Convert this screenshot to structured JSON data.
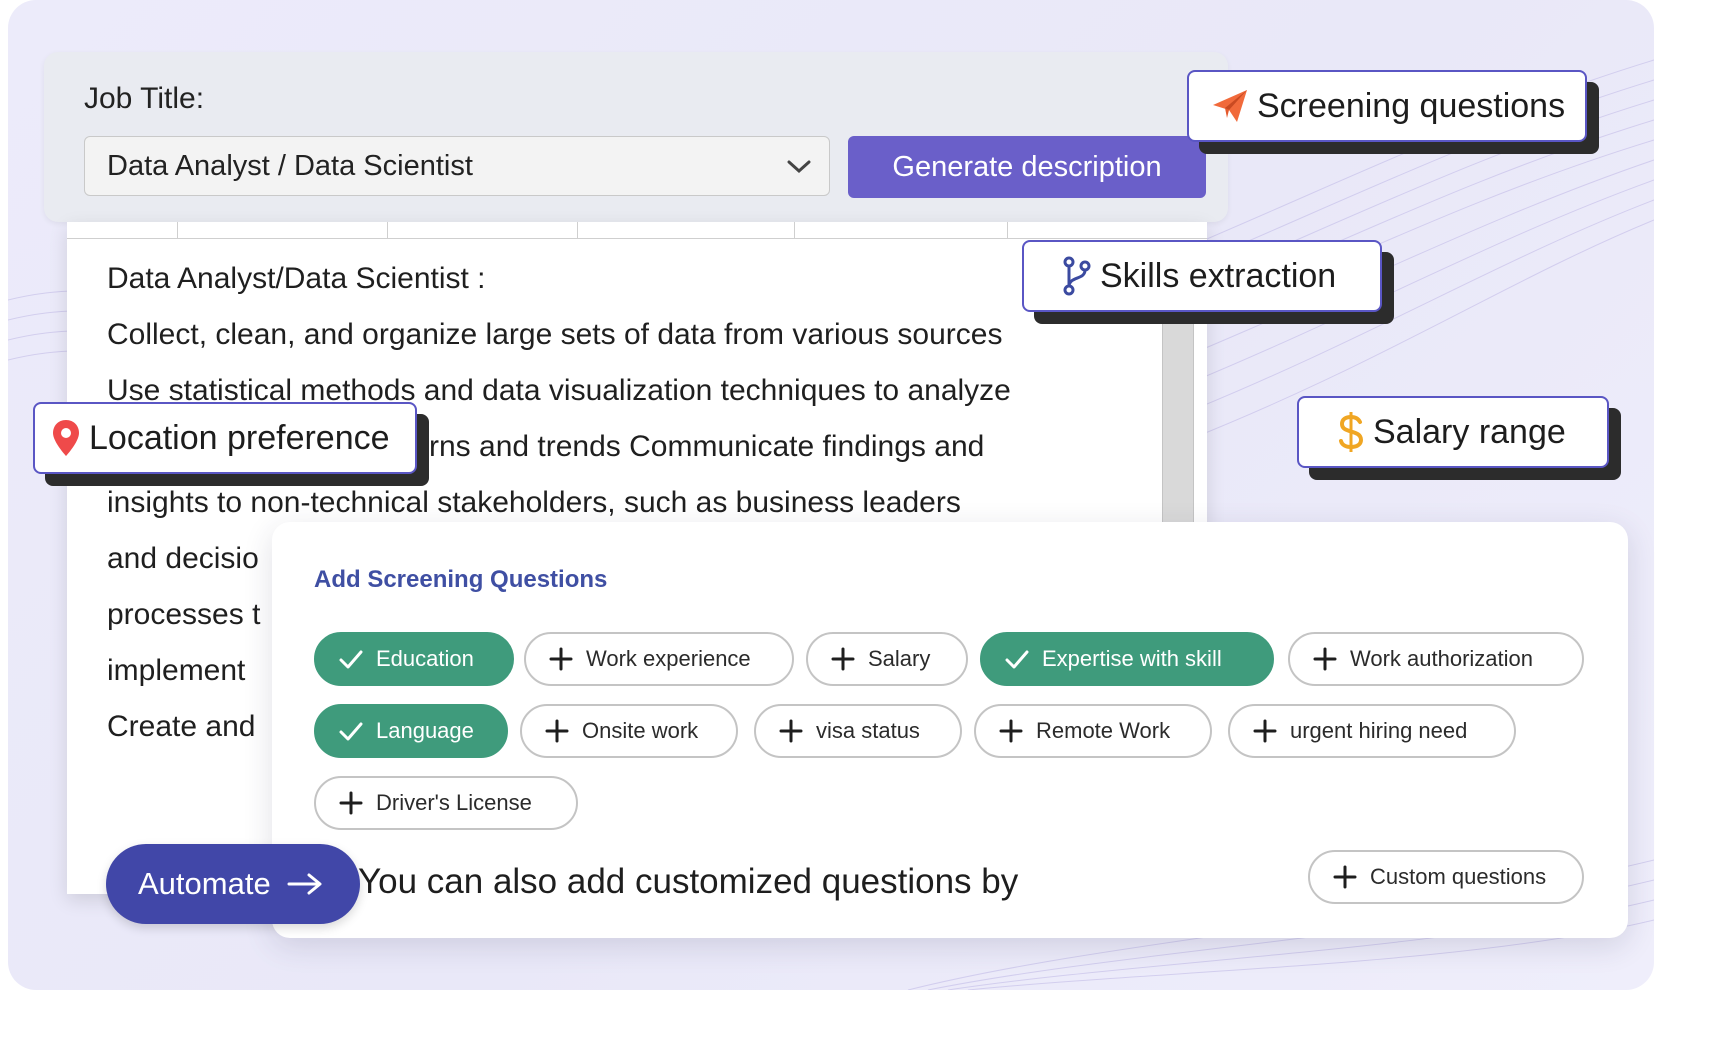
{
  "job": {
    "label": "Job Title:",
    "selected": "Data Analyst / Data Scientist",
    "generate_label": "Generate description"
  },
  "description": {
    "lines": [
      "Data Analyst/Data Scientist :",
      "Collect, clean, and organize large sets of data from various sources",
      "Use statistical methods and data visualization techniques to analyze",
      "rns and trends Communicate findings and",
      "insights to non-technical stakeholders, such as business leaders",
      "and decisio",
      "processes t",
      "implement",
      "Create and"
    ]
  },
  "tags": {
    "screening": "Screening questions",
    "skills": "Skills extraction",
    "location": "Location preference",
    "salary": "Salary range"
  },
  "screening": {
    "title": "Add Screening Questions",
    "chips": [
      {
        "label": "Education",
        "selected": true
      },
      {
        "label": "Work experience",
        "selected": false
      },
      {
        "label": "Salary",
        "selected": false
      },
      {
        "label": "Expertise with skill",
        "selected": true
      },
      {
        "label": "Work authorization",
        "selected": false
      },
      {
        "label": "Language",
        "selected": true
      },
      {
        "label": "Onsite work",
        "selected": false
      },
      {
        "label": "visa status",
        "selected": false
      },
      {
        "label": "Remote Work",
        "selected": false
      },
      {
        "label": "urgent hiring need",
        "selected": false
      },
      {
        "label": "Driver's License",
        "selected": false
      }
    ],
    "note": "You can also add customized questions by",
    "custom_label": "Custom questions"
  },
  "automate_label": "Automate",
  "colors": {
    "accent": "#6a5fc9",
    "selected_chip": "#3f9b7c",
    "automate": "#4147a8",
    "title": "#3f4fa3"
  },
  "icons": {
    "screening": "paper-plane-icon",
    "skills": "branch-icon",
    "location": "map-pin-icon",
    "salary": "dollar-icon",
    "selected_chip": "check-icon",
    "unselected_chip": "plus-icon"
  }
}
